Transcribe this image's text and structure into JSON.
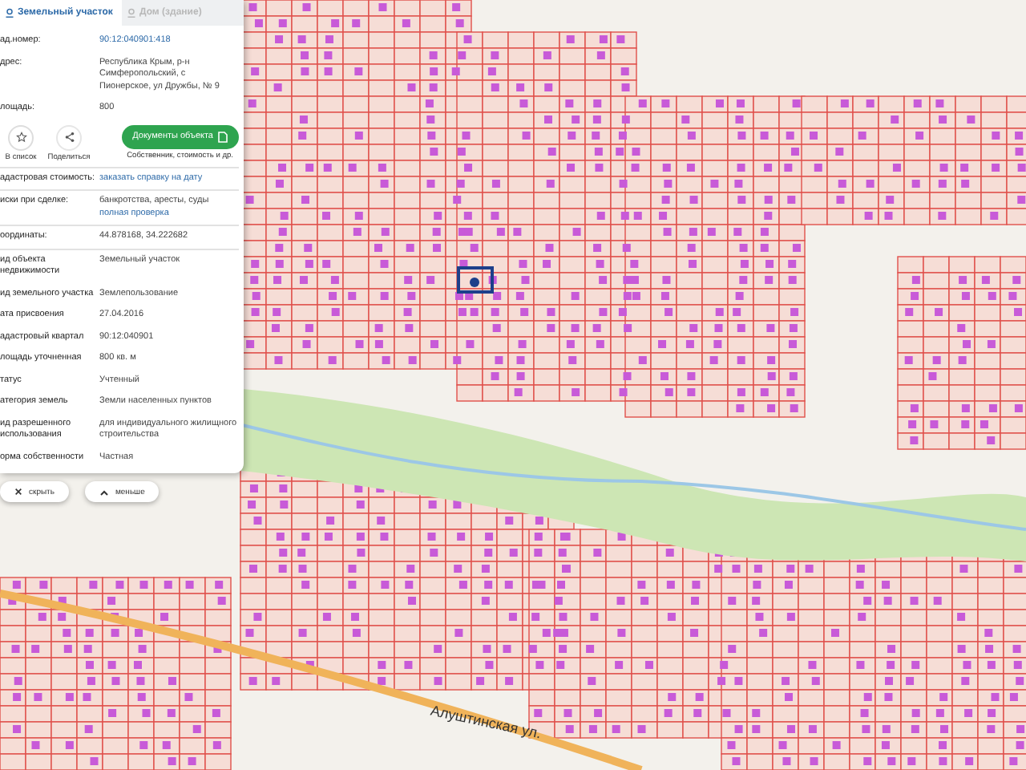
{
  "tabs": [
    {
      "label": "Земельный участок",
      "selected": true
    },
    {
      "label": "Дом (здание)",
      "selected": false
    }
  ],
  "summary": [
    {
      "label": "ад.номер:",
      "value": "90:12:040901:418",
      "kind": "link"
    },
    {
      "label": "дрес:",
      "value": "Республика Крым, р-н Симферопольский, с Пионерское, ул Дружбы, № 9",
      "kind": "text"
    },
    {
      "label": "лощадь:",
      "value": "800",
      "kind": "text"
    }
  ],
  "actions": [
    {
      "label": "В список",
      "kind": "star"
    },
    {
      "label": "Поделиться",
      "kind": "share"
    }
  ],
  "documents_button": {
    "label": "Документы объекта",
    "caption": "Собственник, стоимость и др."
  },
  "details": [
    {
      "label": "адастровая стоимость:",
      "value": "заказать справку на дату",
      "kind": "link"
    },
    {
      "label": "иски при сделке:",
      "value": "банкротства, аресты, суды",
      "link": "полная проверка",
      "kind": "text_link"
    },
    {
      "label": "оординаты:",
      "value": "44.878168, 34.222682",
      "kind": "text"
    },
    {
      "label": "ид объекта недвижимости",
      "value": "Земельный участок",
      "kind": "text"
    },
    {
      "label": "ид земельного участка",
      "value": "Землепользование",
      "kind": "text"
    },
    {
      "label": "ата присвоения",
      "value": "27.04.2016",
      "kind": "text"
    },
    {
      "label": "адастровый квартал",
      "value": "90:12:040901",
      "kind": "text"
    },
    {
      "label": "лощадь уточненная",
      "value": "800 кв. м",
      "kind": "text"
    },
    {
      "label": "татус",
      "value": "Учтенный",
      "kind": "text"
    },
    {
      "label": "атегория земель",
      "value": "Земли населенных пунктов",
      "kind": "text"
    },
    {
      "label": "ид разрешенного использования",
      "value": "для индивидуального жилищного строительства",
      "kind": "text"
    },
    {
      "label": "орма собственности",
      "value": "Частная",
      "kind": "text"
    }
  ],
  "footer_buttons": [
    {
      "label": "скрыть",
      "kind": "close"
    },
    {
      "label": "меньше",
      "kind": "up"
    }
  ],
  "map": {
    "labels": [
      {
        "text": "Алуштинская ул."
      }
    ]
  }
}
